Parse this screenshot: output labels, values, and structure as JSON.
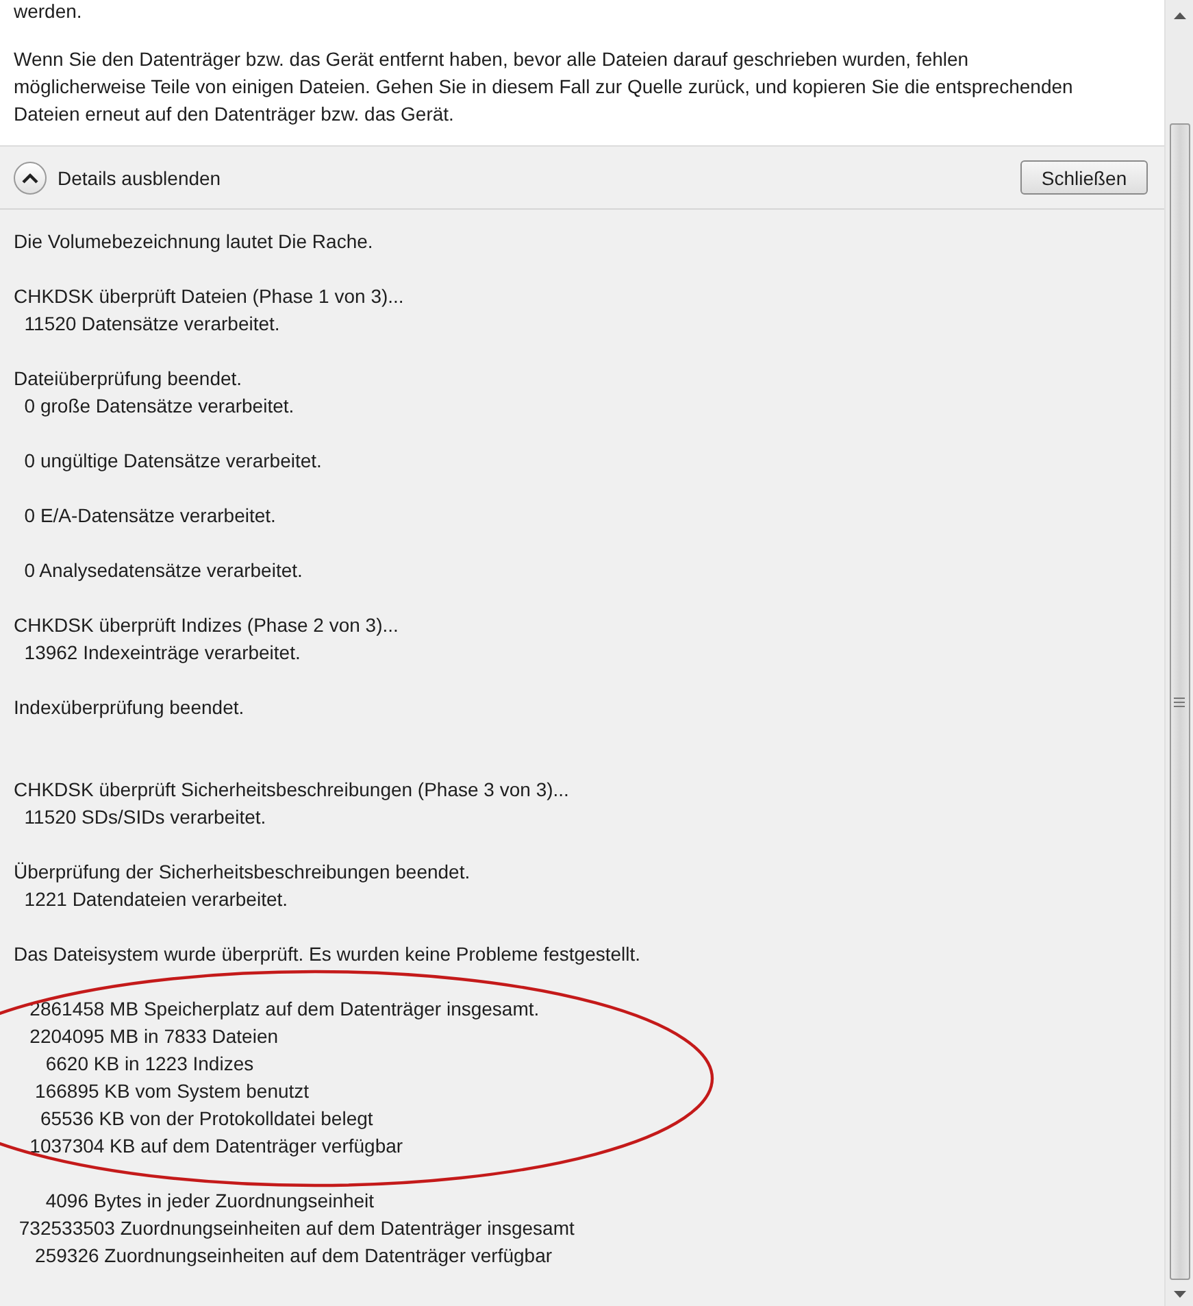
{
  "message": {
    "cut_line": "werden.",
    "paragraph": "Wenn Sie den Datenträger bzw. das Gerät entfernt haben, bevor alle Dateien darauf geschrieben wurden, fehlen möglicherweise Teile von einigen Dateien. Gehen Sie in diesem Fall zur Quelle zurück, und kopieren Sie die entsprechenden Dateien erneut auf den Datenträger bzw. das Gerät."
  },
  "details_bar": {
    "toggle": {
      "label": "Details ausblenden",
      "expanded": true
    },
    "close_button": "Schließen"
  },
  "log": [
    {
      "kind": "line",
      "text": "Die Volumebezeichnung lautet Die Rache."
    },
    {
      "kind": "after_blank",
      "text": "CHKDSK überprüft Dateien (Phase 1 von 3)..."
    },
    {
      "kind": "line",
      "text": "  11520 Datensätze verarbeitet."
    },
    {
      "kind": "after_blank",
      "text": "Dateiüberprüfung beendet."
    },
    {
      "kind": "line",
      "text": "  0 große Datensätze verarbeitet."
    },
    {
      "kind": "after_blank",
      "text": "  0 ungültige Datensätze verarbeitet."
    },
    {
      "kind": "after_blank",
      "text": "  0 E/A-Datensätze verarbeitet."
    },
    {
      "kind": "after_blank",
      "text": "  0 Analysedatensätze verarbeitet."
    },
    {
      "kind": "after_blank",
      "text": "CHKDSK überprüft Indizes (Phase 2 von 3)..."
    },
    {
      "kind": "line",
      "text": "  13962 Indexeinträge verarbeitet."
    },
    {
      "kind": "after_blank",
      "text": "Indexüberprüfung beendet."
    },
    {
      "kind": "after_two_blanks",
      "text": "CHKDSK überprüft Sicherheitsbeschreibungen (Phase 3 von 3)..."
    },
    {
      "kind": "line",
      "text": "  11520 SDs/SIDs verarbeitet."
    },
    {
      "kind": "after_blank",
      "text": "Überprüfung der Sicherheitsbeschreibungen beendet."
    },
    {
      "kind": "line",
      "text": "  1221 Datendateien verarbeitet."
    },
    {
      "kind": "after_blank",
      "text": "Das Dateisystem wurde überprüft. Es wurden keine Probleme festgestellt."
    },
    {
      "kind": "after_blank",
      "text": "   2861458 MB Speicherplatz auf dem Datenträger insgesamt."
    },
    {
      "kind": "line",
      "text": "   2204095 MB in 7833 Dateien"
    },
    {
      "kind": "line",
      "text": "      6620 KB in 1223 Indizes"
    },
    {
      "kind": "line",
      "text": "    166895 KB vom System benutzt"
    },
    {
      "kind": "line",
      "text": "     65536 KB von der Protokolldatei belegt"
    },
    {
      "kind": "line",
      "text": "   1037304 KB auf dem Datenträger verfügbar"
    },
    {
      "kind": "after_blank",
      "text": "      4096 Bytes in jeder Zuordnungseinheit"
    },
    {
      "kind": "line",
      "text": " 732533503 Zuordnungseinheiten auf dem Datenträger insgesamt"
    },
    {
      "kind": "line",
      "text": "    259326 Zuordnungseinheiten auf dem Datenträger verfügbar"
    }
  ]
}
